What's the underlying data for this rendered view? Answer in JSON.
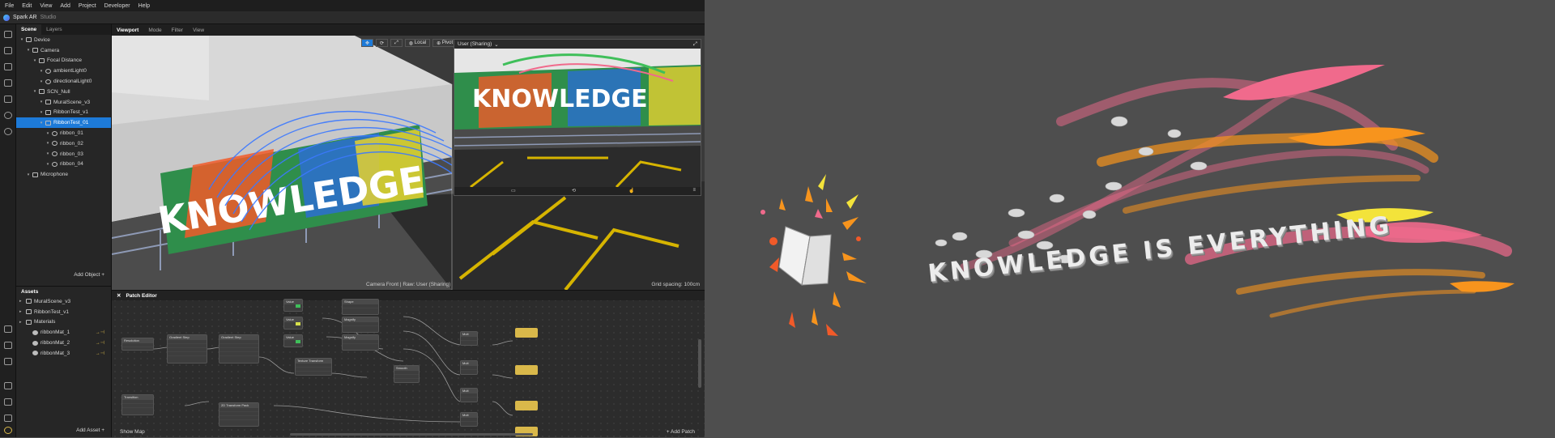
{
  "menu": [
    "File",
    "Edit",
    "View",
    "Add",
    "Project",
    "Developer",
    "Help"
  ],
  "app": {
    "name": "Spark AR",
    "subtitle": "Studio"
  },
  "scene_panel": {
    "tabs": [
      "Scene",
      "Layers"
    ],
    "tree": [
      {
        "label": "Device",
        "depth": 0,
        "icon": "device-icon"
      },
      {
        "label": "Camera",
        "depth": 1,
        "icon": "camera-icon"
      },
      {
        "label": "Focal Distance",
        "depth": 2,
        "icon": "focal-icon"
      },
      {
        "label": "ambientLight0",
        "depth": 3,
        "icon": "light-icon"
      },
      {
        "label": "directionalLight0",
        "depth": 3,
        "icon": "light-icon"
      },
      {
        "label": "SCN_Null",
        "depth": 2,
        "icon": "null-icon"
      },
      {
        "label": "MuralScene_v3",
        "depth": 3,
        "icon": "object-icon"
      },
      {
        "label": "RibbonTest_v1",
        "depth": 3,
        "icon": "object-icon"
      },
      {
        "label": "RibbonTest_01",
        "depth": 3,
        "icon": "object-icon",
        "selected": true
      },
      {
        "label": "ribbon_01",
        "depth": 4,
        "icon": "mesh-icon"
      },
      {
        "label": "ribbon_02",
        "depth": 4,
        "icon": "mesh-icon"
      },
      {
        "label": "ribbon_03",
        "depth": 4,
        "icon": "mesh-icon"
      },
      {
        "label": "ribbon_04",
        "depth": 4,
        "icon": "mesh-icon"
      },
      {
        "label": "Microphone",
        "depth": 1,
        "icon": "microphone-icon"
      }
    ],
    "add_label": "Add Object"
  },
  "assets_panel": {
    "title": "Assets",
    "items": [
      {
        "label": "MuralScene_v3",
        "depth": 0,
        "icon": "folder-icon"
      },
      {
        "label": "RibbonTest_v1",
        "depth": 0,
        "icon": "folder-icon"
      },
      {
        "label": "Materials",
        "depth": 0,
        "icon": "folder-icon"
      },
      {
        "label": "ribbonMat_1",
        "depth": 1,
        "icon": "material-icon"
      },
      {
        "label": "ribbonMat_2",
        "depth": 1,
        "icon": "material-icon"
      },
      {
        "label": "ribbonMat_3",
        "depth": 1,
        "icon": "material-icon"
      }
    ],
    "add_label": "Add Asset"
  },
  "viewport": {
    "tabs": [
      "Viewport",
      "Mode",
      "Filter",
      "View"
    ],
    "tools": [
      "Local",
      "Pivot"
    ],
    "preview_title": "User (Sharing)",
    "mural_text": "KNOWLEDGE",
    "camera_label": "Camera Front | Raw: User (Sharing)",
    "grid_label": "Grid spacing: 100cm"
  },
  "patch_editor": {
    "title": "Patch Editor",
    "show_map": "Show Map",
    "add_patch": "Add Patch"
  },
  "artwork": {
    "headline": "KNOWLEDGE IS EVERYTHING"
  },
  "colors": {
    "accent": "#1d7ad8",
    "ribbon_pink": "#f06a8c",
    "ribbon_orange": "#f7941d",
    "ribbon_yellow": "#f3e33a",
    "patch_output": "#d9b84a"
  }
}
